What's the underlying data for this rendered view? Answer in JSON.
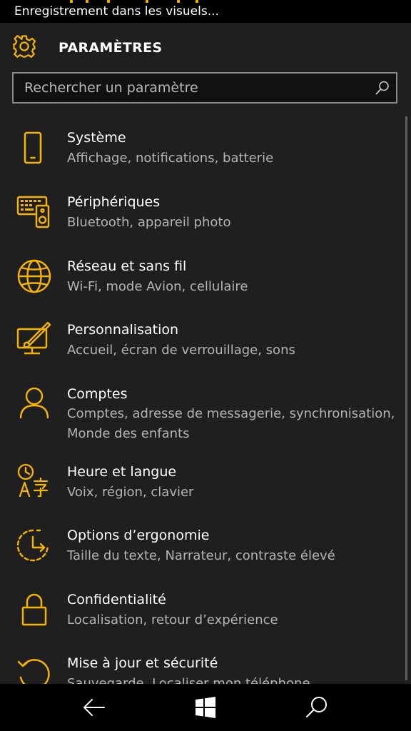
{
  "status_bar": {
    "text": "Enregistrement dans les visuels..."
  },
  "header": {
    "title": "PARAMÈTRES",
    "icon": "gear-icon"
  },
  "search": {
    "placeholder": "Rechercher un paramètre",
    "icon": "search-icon"
  },
  "colors": {
    "accent": "#f5b400",
    "background": "#1f1f1f",
    "subtext": "#b4b4b4"
  },
  "items": [
    {
      "title": "Système",
      "subtitle": "Affichage, notifications, batterie",
      "icon": "phone-icon"
    },
    {
      "title": "Périphériques",
      "subtitle": "Bluetooth, appareil photo",
      "icon": "devices-icon"
    },
    {
      "title": "Réseau et sans fil",
      "subtitle": "Wi-Fi, mode Avion, cellulaire",
      "icon": "globe-icon"
    },
    {
      "title": "Personnalisation",
      "subtitle": "Accueil, écran de verrouillage, sons",
      "icon": "paintbrush-monitor-icon"
    },
    {
      "title": "Comptes",
      "subtitle": "Comptes, adresse de messagerie, synchronisation, Monde des enfants",
      "icon": "person-icon"
    },
    {
      "title": "Heure et langue",
      "subtitle": "Voix, région, clavier",
      "icon": "clock-language-icon"
    },
    {
      "title": "Options d’ergonomie",
      "subtitle": "Taille du texte, Narrateur, contraste élevé",
      "icon": "ease-of-access-icon"
    },
    {
      "title": "Confidentialité",
      "subtitle": "Localisation, retour d’expérience",
      "icon": "lock-icon"
    },
    {
      "title": "Mise à jour et sécurité",
      "subtitle": "Sauvegarde, Localiser mon téléphone",
      "icon": "update-icon"
    }
  ],
  "nav": {
    "back": "back-arrow-icon",
    "home": "windows-logo-icon",
    "search": "search-icon"
  }
}
